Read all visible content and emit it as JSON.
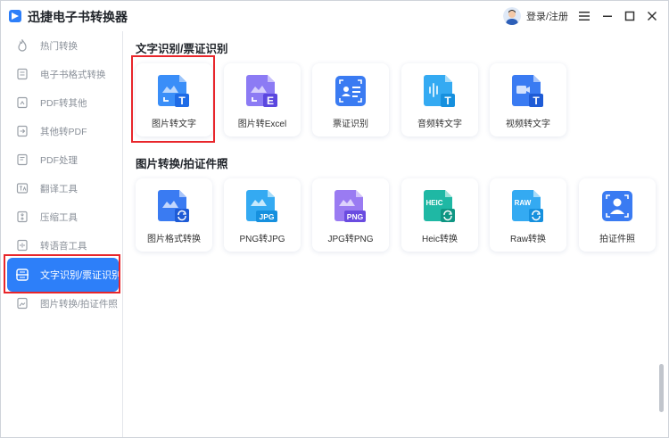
{
  "app": {
    "title": "迅捷电子书转换器",
    "login": "登录/注册"
  },
  "sidebar": {
    "items": [
      {
        "label": "热门转换",
        "icon": "fire-icon"
      },
      {
        "label": "电子书格式转换",
        "icon": "ebook-icon"
      },
      {
        "label": "PDF转其他",
        "icon": "pdf-convert-icon"
      },
      {
        "label": "其他转PDF",
        "icon": "to-pdf-icon"
      },
      {
        "label": "PDF处理",
        "icon": "pdf-process-icon"
      },
      {
        "label": "翻译工具",
        "icon": "translate-icon"
      },
      {
        "label": "压缩工具",
        "icon": "compress-icon"
      },
      {
        "label": "转语音工具",
        "icon": "voice-icon"
      },
      {
        "label": "文字识别/票证识别",
        "icon": "ocr-icon",
        "active": true
      },
      {
        "label": "图片转换/拍证件照",
        "icon": "image-convert-icon"
      }
    ]
  },
  "sections": [
    {
      "title": "文字识别/票证识别",
      "cards": [
        {
          "label": "图片转文字",
          "icon": "image-to-text-icon",
          "color": "#3a8ef8"
        },
        {
          "label": "图片转Excel",
          "icon": "image-to-excel-icon",
          "color": "#7f6cf0"
        },
        {
          "label": "票证识别",
          "icon": "id-card-scan-icon",
          "color": "#3a7bf2"
        },
        {
          "label": "音频转文字",
          "icon": "audio-to-text-icon",
          "color": "#2fa8f0"
        },
        {
          "label": "视频转文字",
          "icon": "video-to-text-icon",
          "color": "#3a7bf2"
        }
      ]
    },
    {
      "title": "图片转换/拍证件照",
      "cards": [
        {
          "label": "图片格式转换",
          "icon": "image-format-icon",
          "color": "#3a7bf2",
          "badge": ""
        },
        {
          "label": "PNG转JPG",
          "icon": "png-to-jpg-icon",
          "color": "#2fa8f0",
          "badge": "JPG"
        },
        {
          "label": "JPG转PNG",
          "icon": "jpg-to-png-icon",
          "color": "#8a6cf0",
          "badge": "PNG"
        },
        {
          "label": "Heic转换",
          "icon": "heic-convert-icon",
          "color": "#1fb8a4",
          "badge": "HEIC"
        },
        {
          "label": "Raw转换",
          "icon": "raw-convert-icon",
          "color": "#2fa8f0",
          "badge": "RAW"
        },
        {
          "label": "拍证件照",
          "icon": "id-photo-icon",
          "color": "#3a7bf2",
          "badge": ""
        }
      ]
    }
  ],
  "colors": {
    "accent": "#2d7ff9",
    "highlight": "#e8262b"
  }
}
